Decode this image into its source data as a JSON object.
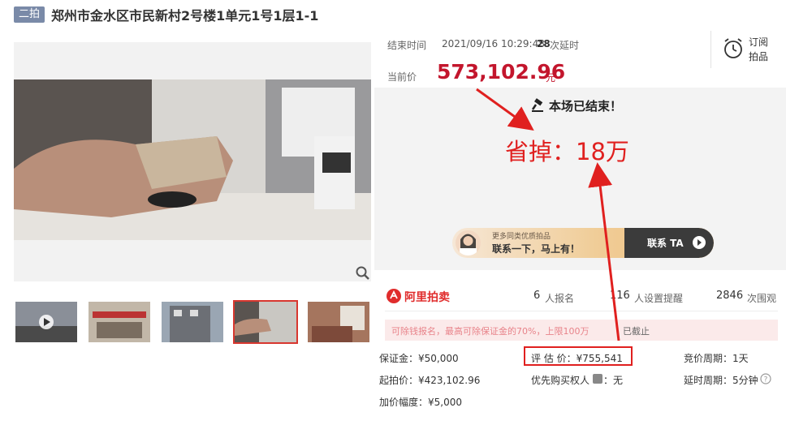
{
  "header": {
    "badge": "二拍",
    "title": "郑州市金水区市民新村2号楼1单元1号1层1-1"
  },
  "auction": {
    "end_label": "结束时间",
    "end_time": "2021/09/16 10:29:48",
    "delay_count": "28",
    "delay_label": "次延时",
    "current_label": "当前价",
    "current_price": "573,102.96",
    "currency": "元",
    "subscribe_line1": "订阅",
    "subscribe_line2": "拍品",
    "ended_text": "本场已结束！",
    "saved_text": "省掉：18万"
  },
  "banner": {
    "line1": "更多同类优质拍品",
    "line2": "联系一下，马上有！",
    "cta": "联系 TA"
  },
  "stats": {
    "platform": "阿里拍卖",
    "signups": "6",
    "signups_label": "人报名",
    "reminders": "116",
    "reminders_label": "人设置提醒",
    "views": "2846",
    "views_label": "次围观"
  },
  "notice": {
    "text": "可除钱报名，最高可除保证金的70%，上限100万",
    "status": "已截止"
  },
  "details": {
    "deposit": "保证金：¥50,000",
    "start_price": "起拍价：¥423,102.96",
    "increment": "加价幅度：¥5,000",
    "eval_price": "评 估 价：¥755,541",
    "priority_label": "优先购买权人",
    "priority_value": "：无",
    "bid_period": "竞价周期：1天",
    "delay_period": "延时周期：5分钟"
  },
  "colors": {
    "accent": "#c3162d",
    "arrow": "#e0201f",
    "badge": "#7a8aa8"
  }
}
